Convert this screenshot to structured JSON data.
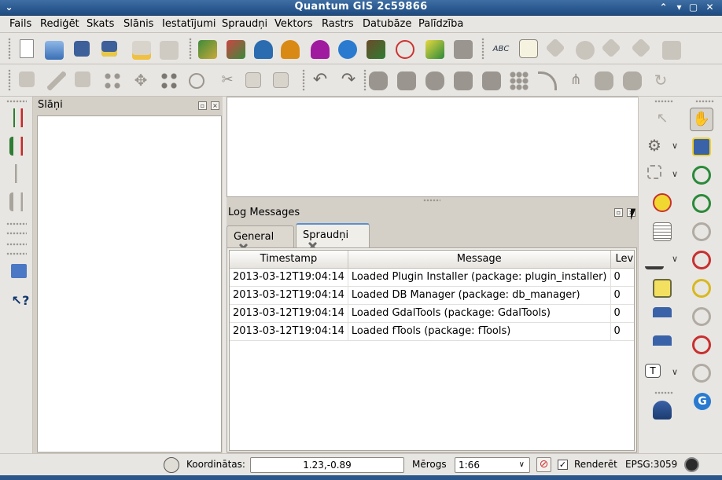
{
  "window": {
    "title": "Quantum GIS 2c59866",
    "minimize_glyph": "⌃",
    "maximize_glyph": "▢",
    "close_glyph": "✕",
    "menu_glyph": "⌄"
  },
  "menu": [
    "Fails",
    "Rediģēt",
    "Skats",
    "Slānis",
    "Iestatījumi",
    "Spraudņi",
    "Vektors",
    "Rastrs",
    "Datubāze",
    "Palīdzība"
  ],
  "layers_panel": {
    "title": "Slāņi"
  },
  "log_panel": {
    "title": "Log Messages",
    "tabs": [
      {
        "label": "General",
        "active": false
      },
      {
        "label": "Spraudņi",
        "active": true
      }
    ],
    "columns": [
      "Timestamp",
      "Message",
      "Level"
    ],
    "rows": [
      {
        "timestamp": "2013-03-12T19:04:14",
        "message": "Loaded Plugin Installer (package: plugin_installer)",
        "level": "0"
      },
      {
        "timestamp": "2013-03-12T19:04:14",
        "message": "Loaded DB Manager (package: db_manager)",
        "level": "0"
      },
      {
        "timestamp": "2013-03-12T19:04:14",
        "message": "Loaded GdalTools (package: GdalTools)",
        "level": "0"
      },
      {
        "timestamp": "2013-03-12T19:04:14",
        "message": "Loaded fTools (package: fTools)",
        "level": "0"
      }
    ]
  },
  "status": {
    "coord_label": "Koordinātas:",
    "coord_value": "1.23,-0.89",
    "scale_label": "Mērogs",
    "scale_value": "1:66",
    "render_label": "Renderēt",
    "render_checked": true,
    "crs": "EPSG:3059"
  },
  "colors": {
    "title_bar": "#2a568c",
    "tab_accent": "#5b8fd0",
    "panel_bg": "#e8e6e2"
  },
  "toolbar_icons": {
    "row1": [
      "new-project-icon",
      "open-project-icon",
      "save-project-icon",
      "save-as-icon",
      "print-composer-icon",
      "print-icon",
      "add-raster-layer-icon",
      "add-wms-icon",
      "add-postgis-icon",
      "add-spatialite-icon",
      "add-mssql-icon",
      "add-wfs-icon",
      "add-vector-icon",
      "add-oracle-icon",
      "new-shapefile-icon",
      "remove-layer-icon",
      "label-abc-icon",
      "label-pin-icon",
      "tag-icon",
      "eye-label-icon",
      "rotate-label-icon",
      "move-label-icon",
      "change-label-icon"
    ],
    "row2": [
      "save-edits-icon",
      "toggle-edit-icon",
      "save-icon",
      "add-feature-icon",
      "move-feature-icon",
      "node-tool-icon",
      "delete-selected-icon",
      "cut-icon",
      "copy-icon",
      "paste-icon",
      "undo-icon",
      "redo-icon",
      "add-ring-icon",
      "add-part-icon",
      "fill-ring-icon",
      "delete-ring-icon",
      "delete-part-icon",
      "reshape-icon",
      "offset-curve-icon",
      "split-icon",
      "merge-icon",
      "merge-attributes-icon",
      "rotate-point-icon"
    ],
    "left": [
      "raster-histogram-icon",
      "stretch-icon",
      "histogram-gray-icon",
      "stretch-gray-icon",
      "bookmark-icon",
      "help-whats-this-icon"
    ],
    "right_col1": [
      "identify-icon",
      "gear-icon",
      "select-icon",
      "deselect-icon",
      "attribute-table-icon",
      "measure-icon",
      "annotation-icon",
      "new-bookmark-icon",
      "home-icon",
      "text-annotation-icon",
      "db-icon"
    ],
    "right_col2": [
      "pan-icon",
      "pan-to-selection-icon",
      "zoom-in-icon",
      "zoom-out-icon",
      "zoom-actual-icon",
      "zoom-full-icon",
      "zoom-layer-icon",
      "zoom-selection-icon",
      "zoom-last-icon",
      "zoom-next-icon",
      "refresh-icon"
    ]
  }
}
